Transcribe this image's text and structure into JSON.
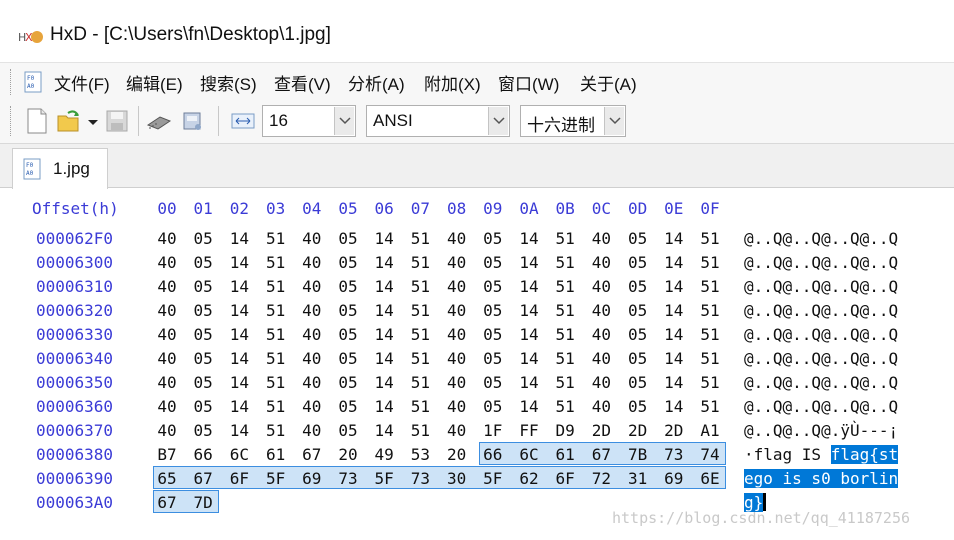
{
  "window": {
    "title": "HxD - [C:\\Users\\fn\\Desktop\\1.jpg]"
  },
  "menu": [
    "文件(F)",
    "编辑(E)",
    "搜索(S)",
    "查看(V)",
    "分析(A)",
    "附加(X)",
    "窗口(W)",
    "关于(A)"
  ],
  "toolbar": {
    "icons": [
      "new-file-icon",
      "open-file-icon",
      "dropdown-arrow-icon",
      "save-icon",
      "ram-icon",
      "disk-icon",
      "columns-icon"
    ],
    "bytes_per_row": "16",
    "charset": "ANSI",
    "offset_base": "十六进制"
  },
  "tab": {
    "label": "1.jpg"
  },
  "hex": {
    "offset_header": "Offset(h)",
    "columns": [
      "00",
      "01",
      "02",
      "03",
      "04",
      "05",
      "06",
      "07",
      "08",
      "09",
      "0A",
      "0B",
      "0C",
      "0D",
      "0E",
      "0F"
    ],
    "rows": [
      {
        "offset": "000062F0",
        "bytes": [
          "40",
          "05",
          "14",
          "51",
          "40",
          "05",
          "14",
          "51",
          "40",
          "05",
          "14",
          "51",
          "40",
          "05",
          "14",
          "51"
        ],
        "ascii": "@..Q@..Q@..Q@..Q"
      },
      {
        "offset": "00006300",
        "bytes": [
          "40",
          "05",
          "14",
          "51",
          "40",
          "05",
          "14",
          "51",
          "40",
          "05",
          "14",
          "51",
          "40",
          "05",
          "14",
          "51"
        ],
        "ascii": "@..Q@..Q@..Q@..Q"
      },
      {
        "offset": "00006310",
        "bytes": [
          "40",
          "05",
          "14",
          "51",
          "40",
          "05",
          "14",
          "51",
          "40",
          "05",
          "14",
          "51",
          "40",
          "05",
          "14",
          "51"
        ],
        "ascii": "@..Q@..Q@..Q@..Q"
      },
      {
        "offset": "00006320",
        "bytes": [
          "40",
          "05",
          "14",
          "51",
          "40",
          "05",
          "14",
          "51",
          "40",
          "05",
          "14",
          "51",
          "40",
          "05",
          "14",
          "51"
        ],
        "ascii": "@..Q@..Q@..Q@..Q"
      },
      {
        "offset": "00006330",
        "bytes": [
          "40",
          "05",
          "14",
          "51",
          "40",
          "05",
          "14",
          "51",
          "40",
          "05",
          "14",
          "51",
          "40",
          "05",
          "14",
          "51"
        ],
        "ascii": "@..Q@..Q@..Q@..Q"
      },
      {
        "offset": "00006340",
        "bytes": [
          "40",
          "05",
          "14",
          "51",
          "40",
          "05",
          "14",
          "51",
          "40",
          "05",
          "14",
          "51",
          "40",
          "05",
          "14",
          "51"
        ],
        "ascii": "@..Q@..Q@..Q@..Q"
      },
      {
        "offset": "00006350",
        "bytes": [
          "40",
          "05",
          "14",
          "51",
          "40",
          "05",
          "14",
          "51",
          "40",
          "05",
          "14",
          "51",
          "40",
          "05",
          "14",
          "51"
        ],
        "ascii": "@..Q@..Q@..Q@..Q"
      },
      {
        "offset": "00006360",
        "bytes": [
          "40",
          "05",
          "14",
          "51",
          "40",
          "05",
          "14",
          "51",
          "40",
          "05",
          "14",
          "51",
          "40",
          "05",
          "14",
          "51"
        ],
        "ascii": "@..Q@..Q@..Q@..Q"
      },
      {
        "offset": "00006370",
        "bytes": [
          "40",
          "05",
          "14",
          "51",
          "40",
          "05",
          "14",
          "51",
          "40",
          "1F",
          "FF",
          "D9",
          "2D",
          "2D",
          "2D",
          "A1"
        ],
        "ascii": "@..Q@..Q@.ÿÙ---¡"
      },
      {
        "offset": "00006380",
        "bytes": [
          "B7",
          "66",
          "6C",
          "61",
          "67",
          "20",
          "49",
          "53",
          "20",
          "66",
          "6C",
          "61",
          "67",
          "7B",
          "73",
          "74"
        ],
        "ascii": "·flag IS ",
        "ascii_sel": "flag{st"
      },
      {
        "offset": "00006390",
        "bytes": [
          "65",
          "67",
          "6F",
          "5F",
          "69",
          "73",
          "5F",
          "73",
          "30",
          "5F",
          "62",
          "6F",
          "72",
          "31",
          "69",
          "6E"
        ],
        "ascii": "",
        "ascii_sel": "ego is s0 borlin"
      },
      {
        "offset": "000063A0",
        "bytes": [
          "67",
          "7D"
        ],
        "ascii": "",
        "ascii_sel": "g}"
      }
    ]
  },
  "watermark": "https://blog.csdn.net/qq_41187256",
  "colors": {
    "offset_blue": "#3b3bd6",
    "selection_fill": "#cde3f7",
    "selection_border": "#3c8ee0",
    "ascii_selection": "#0078d7"
  }
}
